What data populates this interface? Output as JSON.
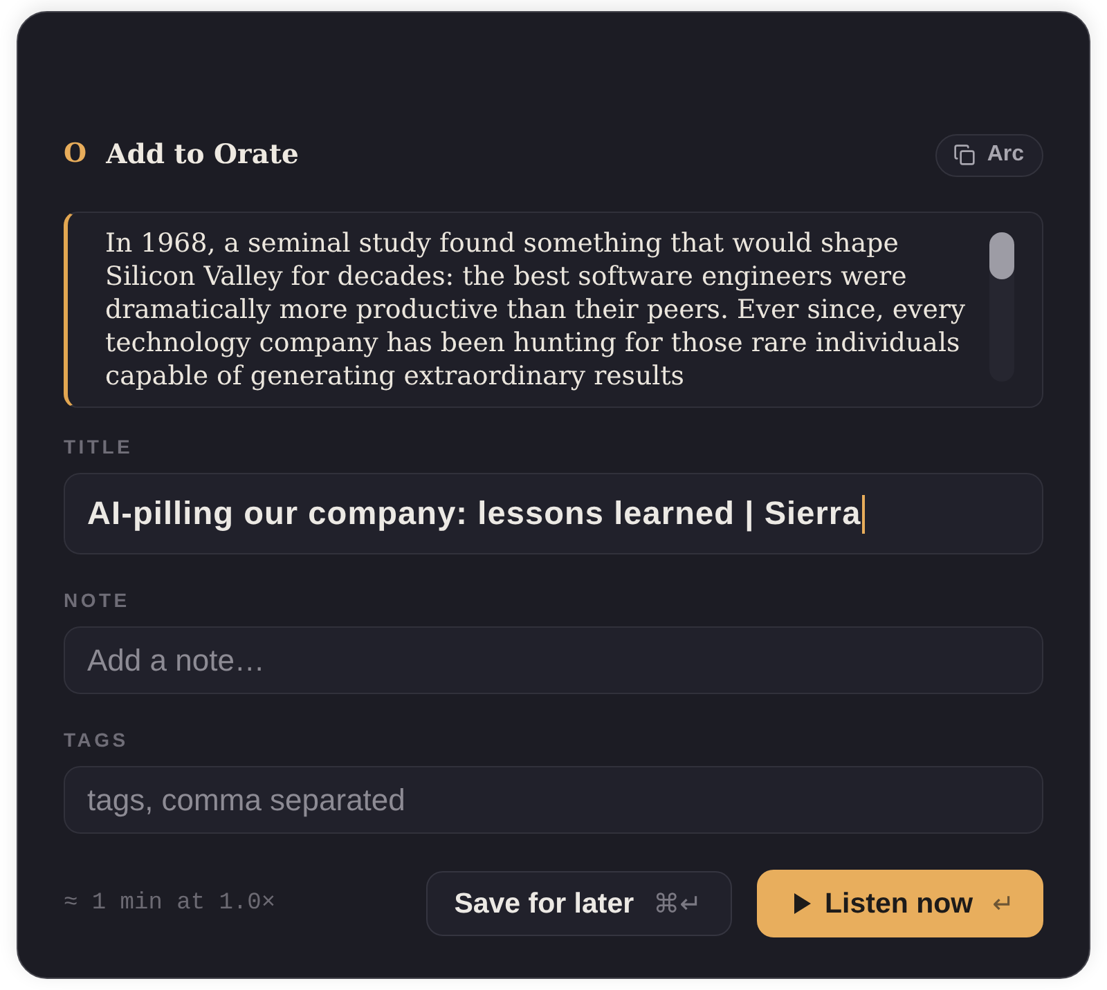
{
  "header": {
    "logo": "O",
    "title": "Add to Orate",
    "source_chip": {
      "label": "Arc"
    }
  },
  "excerpt": {
    "text": "In 1968, a seminal study found something that would shape Silicon Valley for decades: the best software engineers were dramatically more productive than their peers. Ever since, every technology company has been hunting for those rare individuals capable of generating extraordinary results"
  },
  "fields": [
    {
      "label": "TITLE",
      "kind": "title",
      "value": "AI-pilling our company: lessons learned | Sierra",
      "focused": true
    },
    {
      "label": "NOTE",
      "kind": "text",
      "placeholder": "Add a note…",
      "focused": false
    },
    {
      "label": "TAGS",
      "kind": "text",
      "placeholder": "tags, comma separated",
      "focused": false
    }
  ],
  "footer": {
    "estimate": "≈ 1 min at 1.0×",
    "buttons": [
      {
        "kind": "secondary",
        "label": "Save for later",
        "shortcut": "⌘↵"
      },
      {
        "kind": "primary",
        "label": "Listen now",
        "shortcut": "↵"
      }
    ]
  }
}
